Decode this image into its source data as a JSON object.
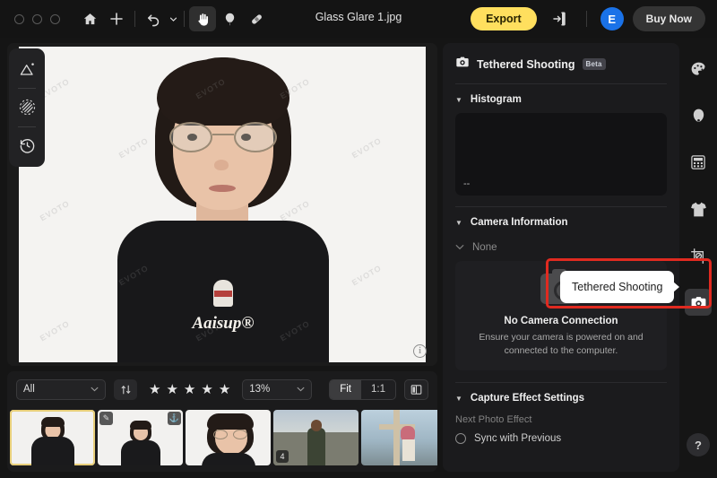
{
  "window": {
    "title": "Glass Glare 1.jpg"
  },
  "topbar": {
    "home_icon": "home-icon",
    "add_icon": "plus-icon",
    "undo_icon": "undo-icon",
    "undo_chevron": "chevron-down-icon",
    "hand_icon": "hand-tool-icon",
    "retouch_icon": "retouch-tool-icon",
    "healing_icon": "bandage-tool-icon",
    "export_label": "Export",
    "share_icon": "share-export-icon",
    "avatar_letter": "E",
    "buy_label": "Buy Now"
  },
  "left_rail": {
    "items": [
      {
        "name": "ai-enhance-icon"
      },
      {
        "name": "selection-brush-icon"
      },
      {
        "name": "history-icon"
      }
    ]
  },
  "canvas": {
    "watermark": "EVOTO",
    "shirt_text": "Aaisup®",
    "info_icon": "info-icon",
    "info_label": "i"
  },
  "strip_toolbar": {
    "filter_value": "All",
    "filter_options": [
      "All"
    ],
    "sort_icon": "sort-icon",
    "stars": [
      "★",
      "★",
      "★",
      "★",
      "★"
    ],
    "star_count": 5,
    "zoom_value": "13%",
    "zoom_options": [
      "13%"
    ],
    "fit_label": "Fit",
    "one_to_one_label": "1:1",
    "compare_icon": "compare-view-icon",
    "chevron": "⌄"
  },
  "filmstrip": {
    "thumbs": [
      {
        "name": "thumb-1",
        "selected": true,
        "badge_left": "",
        "badge_right": "",
        "num": ""
      },
      {
        "name": "thumb-2",
        "selected": false,
        "badge_left": "✎",
        "badge_right": "⚓",
        "num": ""
      },
      {
        "name": "thumb-3",
        "selected": false,
        "badge_left": "",
        "badge_right": "",
        "num": ""
      },
      {
        "name": "thumb-4",
        "selected": false,
        "badge_left": "",
        "badge_right": "",
        "num": "4"
      },
      {
        "name": "thumb-5",
        "selected": false,
        "badge_left": "",
        "badge_right": "",
        "num": ""
      },
      {
        "name": "thumb-6",
        "selected": false,
        "badge_left": "",
        "badge_right": "",
        "num": ""
      }
    ]
  },
  "right_panel": {
    "camera_icon": "camera-icon",
    "title": "Tethered Shooting",
    "beta_label": "Beta",
    "histogram": {
      "label": "Histogram",
      "empty_value": "--"
    },
    "camera_information": {
      "label": "Camera Information",
      "selected": "None",
      "no_connection_title": "No Camera Connection",
      "no_connection_desc": "Ensure your camera is powered on and connected to the computer.",
      "placeholder_icon": "camera-placeholder-icon"
    },
    "capture_effect": {
      "label": "Capture Effect Settings",
      "next_photo_effect": "Next Photo Effect",
      "sync_label": "Sync with Previous"
    }
  },
  "icon_rail": {
    "items": [
      {
        "name": "palette-icon",
        "active": false
      },
      {
        "name": "face-retouch-icon",
        "active": false
      },
      {
        "name": "background-grid-icon",
        "active": false
      },
      {
        "name": "clothing-icon",
        "active": false
      },
      {
        "name": "crop-icon",
        "active": false
      },
      {
        "name": "tethered-camera-icon",
        "active": true
      }
    ],
    "help_label": "?"
  },
  "tooltip": {
    "text": "Tethered Shooting"
  },
  "colors": {
    "accent_yellow": "#ffdf5e",
    "highlight_red": "#e02a20",
    "avatar_blue": "#1a72e8",
    "selected_thumb": "#e8cf7a"
  }
}
